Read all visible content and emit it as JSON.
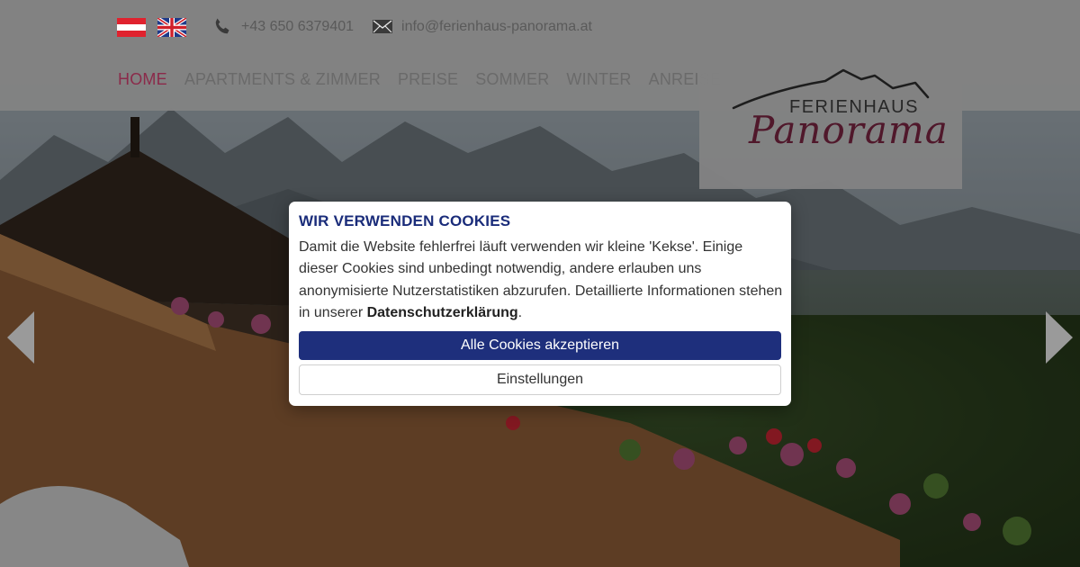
{
  "header": {
    "phone": "+43 650 6379401",
    "email": "info@ferienhaus-panorama.at",
    "languages": [
      {
        "code": "at",
        "icon": "austria-flag-icon"
      },
      {
        "code": "en",
        "icon": "uk-flag-icon"
      }
    ]
  },
  "nav": {
    "items": [
      {
        "label": "HOME",
        "active": true
      },
      {
        "label": "APARTMENTS & ZIMMER",
        "active": false
      },
      {
        "label": "PREISE",
        "active": false
      },
      {
        "label": "SOMMER",
        "active": false
      },
      {
        "label": "WINTER",
        "active": false
      },
      {
        "label": "ANREISE",
        "active": false
      }
    ]
  },
  "logo": {
    "line1": "FERIENHAUS",
    "line2": "Panorama"
  },
  "cookie": {
    "title": "WIR VERWENDEN COOKIES",
    "text_before": "Damit die Website fehlerfrei läuft verwenden wir kleine 'Kekse'. Einige dieser Cookies sind unbedingt notwendig, andere erlauben uns anonymisierte Nutzerstatistiken abzurufen. Detaillierte Informationen stehen in unserer ",
    "privacy_link": "Datenschutzerklärung",
    "text_after": ".",
    "accept_label": "Alle Cookies akzeptieren",
    "settings_label": "Einstellungen"
  },
  "colors": {
    "accent": "#8b2a4a",
    "primary_button": "#1e2f7c",
    "title": "#1a2c7a"
  }
}
